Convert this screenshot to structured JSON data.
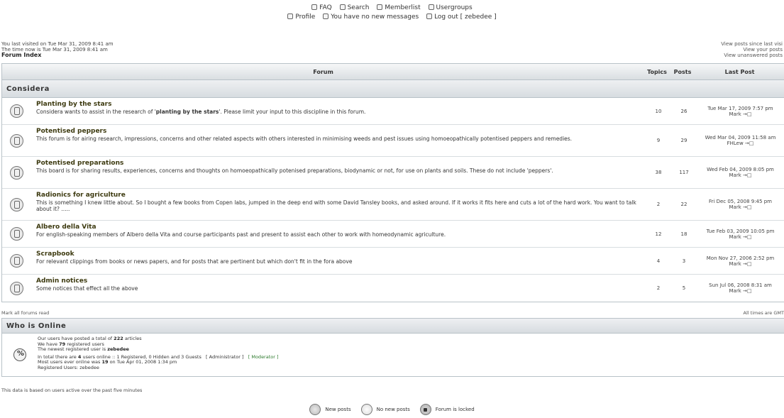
{
  "topnav": {
    "faq": "FAQ",
    "search": "Search",
    "memberlist": "Memberlist",
    "usergroups": "Usergroups",
    "profile": "Profile",
    "messages": "You have no new messages",
    "logout": "Log out [ zebedee ]"
  },
  "info": {
    "last_visit": "You last visited on Tue Mar 31, 2009 8:41 am",
    "time_now": "The time now is Tue Mar 31, 2009 8:41 am",
    "forum_index": "Forum Index",
    "view_since_last": "View posts since last visi",
    "view_your": "View your posts",
    "view_unanswered": "View unanswered posts"
  },
  "table": {
    "col_forum": "Forum",
    "col_topics": "Topics",
    "col_posts": "Posts",
    "col_last": "Last Post"
  },
  "category": "Considera",
  "forums": [
    {
      "name": "Planting by the stars",
      "desc_pre": "Considera wants to assist in the research of '",
      "desc_bold": "planting by the stars",
      "desc_post": "'. Please limit your input to this discipline in this forum.",
      "topics": "10",
      "posts": "26",
      "last_date": "Tue Mar 17, 2009 7:57 pm",
      "last_user": "Mark →□"
    },
    {
      "name": "Potentised peppers",
      "desc_pre": "This forum is for airing research, impressions, concerns and other related aspects with others interested in minimising weeds and pest issues using homoeopathically potentised peppers and remedies.",
      "desc_bold": "",
      "desc_post": "",
      "topics": "9",
      "posts": "29",
      "last_date": "Wed Mar 04, 2009 11:58 am",
      "last_user": "FHLew →□"
    },
    {
      "name": "Potentised preparations",
      "desc_pre": "This board is for sharing results, experiences, concerns and thoughts on homoeopathically potenised preparations, biodynamic or not, for use on plants and soils. These do not include 'peppers'.",
      "desc_bold": "",
      "desc_post": "",
      "topics": "38",
      "posts": "117",
      "last_date": "Wed Feb 04, 2009 8:05 pm",
      "last_user": "Mark →□"
    },
    {
      "name": "Radionics for agriculture",
      "desc_pre": "This is something I knew little about. So I bought a few books from Copen labs, jumped in the deep end with some David Tansley books, and asked around. If it works it fits here and cuts a lot of the hard work. You want to talk about it? .....",
      "desc_bold": "",
      "desc_post": "",
      "topics": "2",
      "posts": "22",
      "last_date": "Fri Dec 05, 2008 9:45 pm",
      "last_user": "Mark →□"
    },
    {
      "name": "Albero della Vita",
      "desc_pre": "For english-speaking members of Albero della Vita and course participants past and present to assist each other to work with homeodynamic agriculture.",
      "desc_bold": "",
      "desc_post": "",
      "topics": "12",
      "posts": "18",
      "last_date": "Tue Feb 03, 2009 10:05 pm",
      "last_user": "Mark →□"
    },
    {
      "name": "Scrapbook",
      "desc_pre": "For relevant clippings from books or news papers, and for posts that are pertinent but which don't fit in the fora above",
      "desc_bold": "",
      "desc_post": "",
      "topics": "4",
      "posts": "3",
      "last_date": "Mon Nov 27, 2006 2:52 pm",
      "last_user": "Mark →□"
    },
    {
      "name": "Admin notices",
      "desc_pre": "Some notices that effect all the above",
      "desc_bold": "",
      "desc_post": "",
      "topics": "2",
      "posts": "5",
      "last_date": "Sun Jul 06, 2008 8:31 am",
      "last_user": "Mark →□"
    }
  ],
  "below": {
    "mark_read": "Mark all forums read",
    "timezone": "All times are GMT"
  },
  "online": {
    "title": "Who is Online",
    "posted_pre": "Our users have posted a total of ",
    "posted_num": "222",
    "posted_post": " articles",
    "reg_pre": "We have ",
    "reg_num": "79",
    "reg_post": " registered users",
    "newest_pre": "The newest registered user is ",
    "newest_user": "zebedee",
    "total_pre": "In total there are ",
    "total_num": "4",
    "total_post": " users online :: 1 Registered, 0 Hidden and 3 Guests",
    "admin": "[ Administrator ]",
    "moderator": "[ Moderator ]",
    "most_pre": "Most users ever online was ",
    "most_num": "19",
    "most_post": " on Tue Apr 01, 2008 1:34 pm",
    "registered_users": "Registered Users: zebedee",
    "active_note": "This data is based on users active over the past five minutes"
  },
  "legend": {
    "new_posts": "New posts",
    "no_new_posts": "No new posts",
    "locked": "Forum is locked"
  }
}
